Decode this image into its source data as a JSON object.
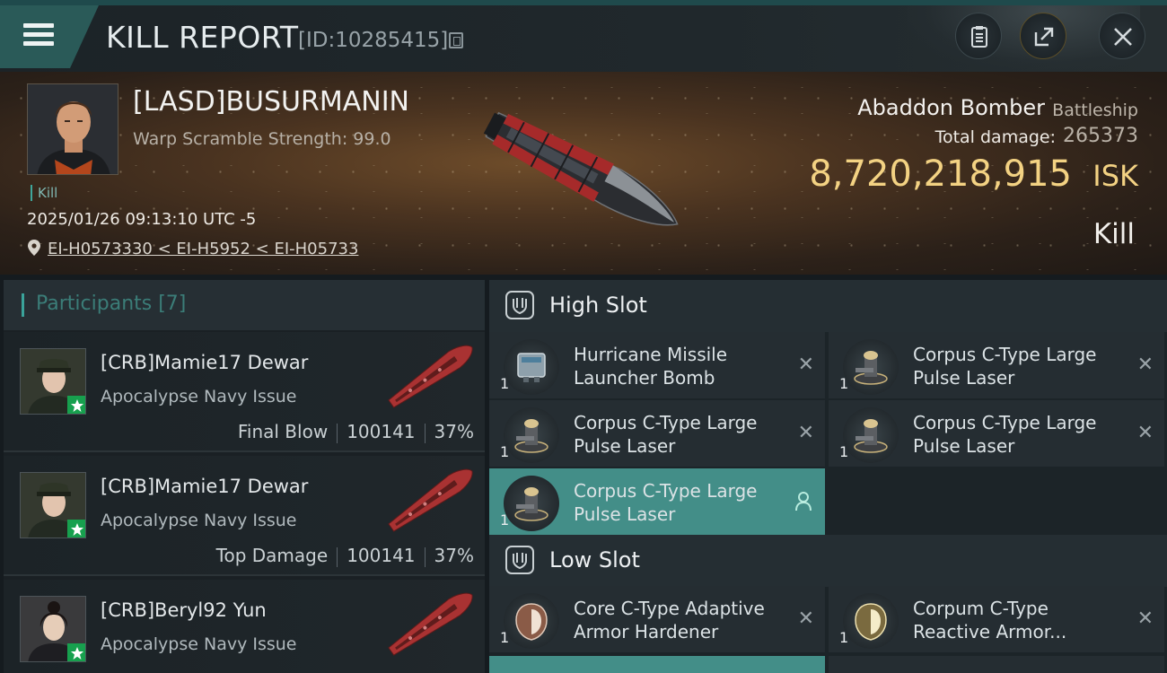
{
  "header": {
    "title": "KILL REPORT",
    "report_id": "[ID:10285415]",
    "buttons": [
      "clipboard-icon",
      "export-icon",
      "close-icon"
    ]
  },
  "victim": {
    "name": "[LASD]BUSURMANIN",
    "warp_scramble": "Warp Scramble Strength: 99.0",
    "kill_tag": "Kill",
    "datetime": "2025/01/26 09:13:10 UTC -5",
    "location": "EI-H0573330 < EI-H5952 < EI-H05733",
    "ship_name": "Abaddon Bomber",
    "ship_class": "Battleship",
    "total_damage_label": "Total damage:",
    "total_damage": "265373",
    "isk_value": "8,720,218,915",
    "isk_unit": "ISK",
    "result": "Kill"
  },
  "participants": {
    "title": "Participants [7]",
    "rows": [
      {
        "name": "[CRB]Mamie17 Dewar",
        "ship": "Apocalypse Navy Issue",
        "role": "Final Blow",
        "damage": "100141",
        "percent": "37%"
      },
      {
        "name": "[CRB]Mamie17 Dewar",
        "ship": "Apocalypse Navy Issue",
        "role": "Top Damage",
        "damage": "100141",
        "percent": "37%"
      },
      {
        "name": "[CRB]Beryl92 Yun",
        "ship": "Apocalypse Navy Issue"
      }
    ]
  },
  "slots": {
    "high": {
      "label": "High Slot",
      "modules": [
        {
          "line1": "Hurricane Missile",
          "line2": "Launcher Bomb",
          "qty": "1",
          "status": "destroyed"
        },
        {
          "line1": "Corpus C-Type Large",
          "line2": "Pulse Laser",
          "qty": "1",
          "status": "destroyed"
        },
        {
          "line1": "Corpus C-Type Large",
          "line2": "Pulse Laser",
          "qty": "1",
          "status": "destroyed"
        },
        {
          "line1": "Corpus C-Type Large",
          "line2": "Pulse Laser",
          "qty": "1",
          "status": "destroyed"
        },
        {
          "line1": "Corpus C-Type Large",
          "line2": "Pulse Laser",
          "qty": "1",
          "status": "dropped"
        }
      ]
    },
    "low": {
      "label": "Low Slot",
      "modules": [
        {
          "line1": "Core C-Type Adaptive",
          "line2": "Armor Hardener",
          "qty": "1",
          "status": "destroyed"
        },
        {
          "line1": "Corpum C-Type",
          "line2": "Reactive Armor...",
          "qty": "1",
          "status": "destroyed"
        }
      ]
    }
  },
  "colors": {
    "accent": "#3aa39a",
    "isk": "#f3d283",
    "active_module": "#438e88"
  }
}
